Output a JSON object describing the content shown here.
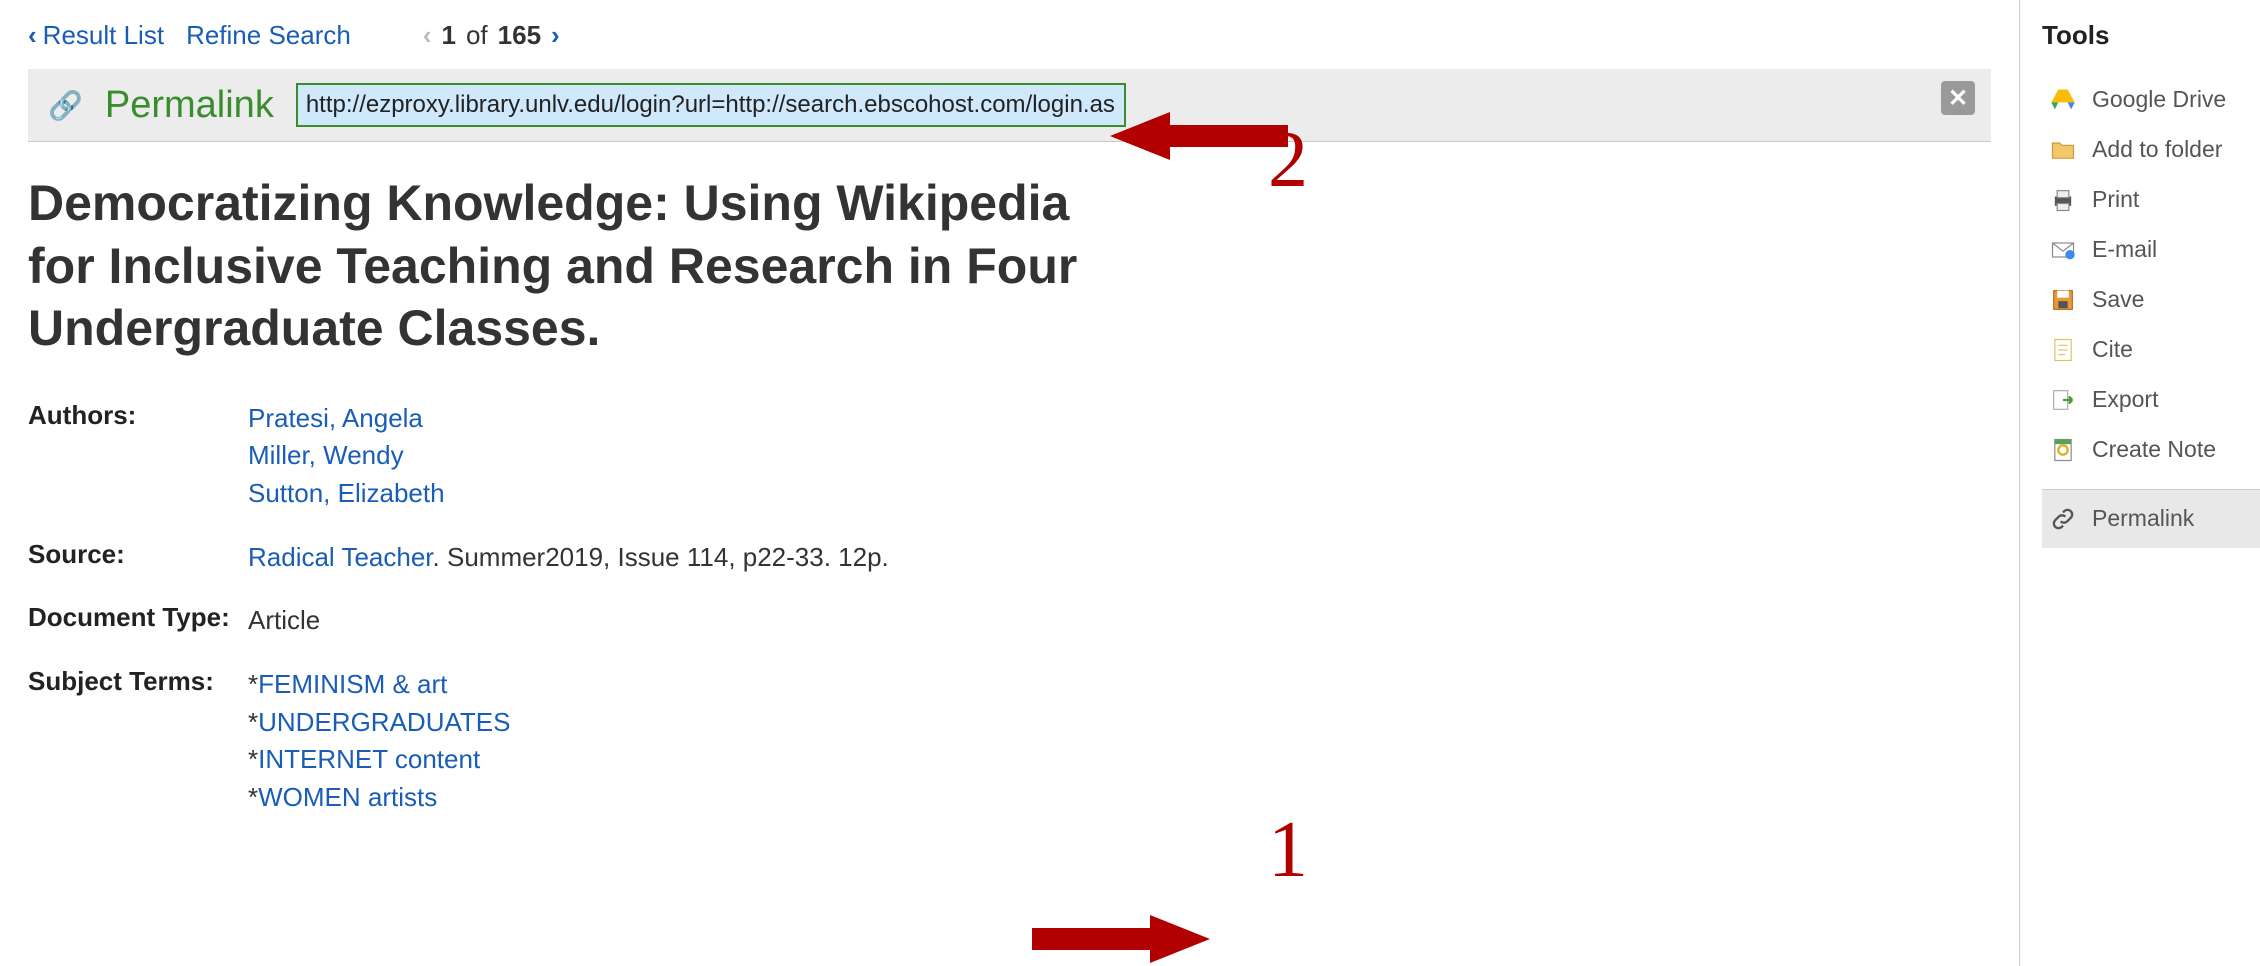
{
  "nav": {
    "result_list": "Result List",
    "refine_search": "Refine Search",
    "paging_current": "1",
    "paging_of": "of",
    "paging_total": "165"
  },
  "permalink": {
    "label": "Permalink",
    "url": "http://ezproxy.library.unlv.edu/login?url=http://search.ebscohost.com/login.aspx?direct=tru"
  },
  "title": "Democratizing Knowledge: Using Wikipedia for Inclusive Teaching and Research in Four Undergraduate Classes.",
  "meta": {
    "authors_label": "Authors:",
    "authors": [
      "Pratesi, Angela",
      "Miller, Wendy",
      "Sutton, Elizabeth"
    ],
    "source_label": "Source:",
    "source_link": "Radical Teacher",
    "source_rest": ". Summer2019, Issue 114, p22-33. 12p.",
    "doctype_label": "Document Type:",
    "doctype": "Article",
    "subjects_label": "Subject Terms:",
    "subjects": [
      "FEMINISM & art",
      "UNDERGRADUATES",
      "INTERNET content",
      "WOMEN artists"
    ]
  },
  "tools": {
    "heading": "Tools",
    "google_drive": "Google Drive",
    "add_folder": "Add to folder",
    "print": "Print",
    "email": "E-mail",
    "save": "Save",
    "cite": "Cite",
    "export": "Export",
    "create_note": "Create Note",
    "permalink": "Permalink"
  },
  "annotations": {
    "num1": "1",
    "num2": "2"
  }
}
